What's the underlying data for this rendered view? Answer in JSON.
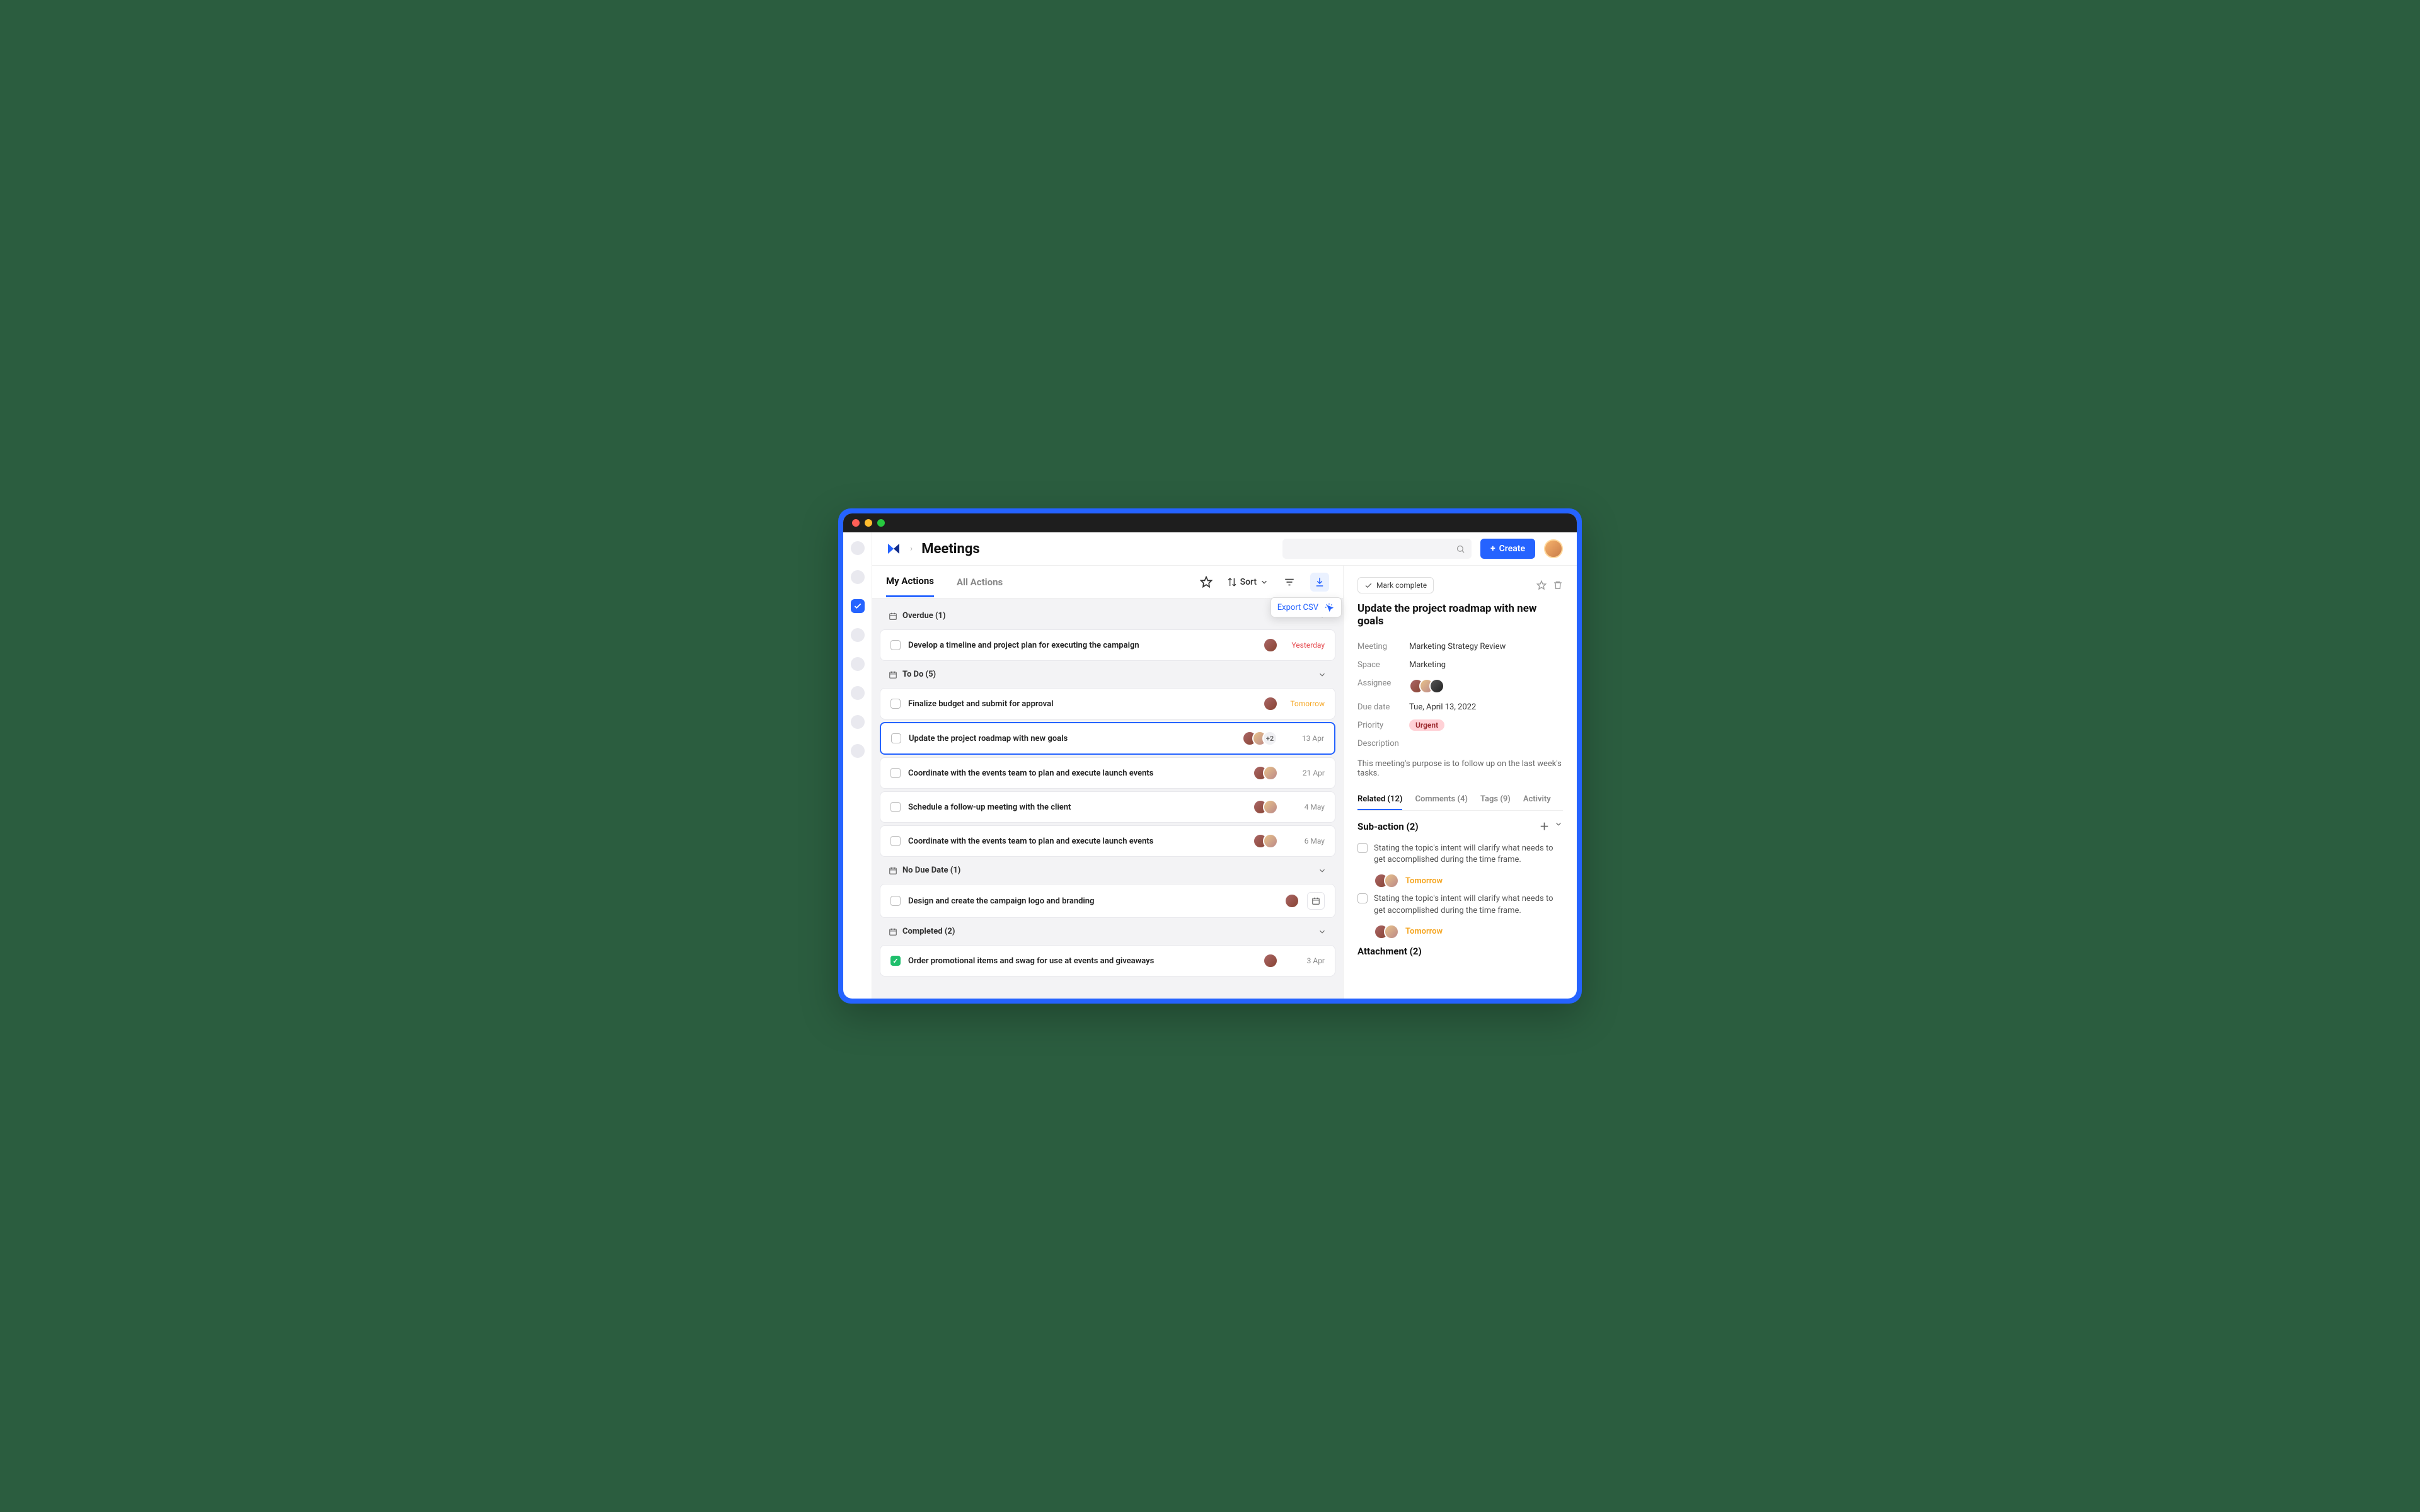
{
  "header": {
    "page_title": "Meetings",
    "create_label": "Create",
    "search_placeholder": ""
  },
  "tabs": {
    "my_actions": "My Actions",
    "all_actions": "All Actions",
    "sort_label": "Sort",
    "export_tooltip": "Export CSV"
  },
  "groups": {
    "overdue": {
      "label": "Overdue (1)",
      "items": [
        {
          "title": "Develop a timeline and project plan for executing the campaign",
          "due": "Yesterday",
          "due_class": "red",
          "avatars": 1
        }
      ]
    },
    "todo": {
      "label": "To Do (5)",
      "items": [
        {
          "title": "Finalize budget and submit for approval",
          "due": "Tomorrow",
          "due_class": "orange",
          "avatars": 1
        },
        {
          "title": "Update the project roadmap with new goals",
          "due": "13 Apr",
          "due_class": "",
          "avatars": 2,
          "extra": "+2",
          "selected": true
        },
        {
          "title": "Coordinate with the events team to plan and execute launch events",
          "due": "21 Apr",
          "due_class": "",
          "avatars": 2
        },
        {
          "title": "Schedule a follow-up meeting with the client",
          "due": "4 May",
          "due_class": "",
          "avatars": 2
        },
        {
          "title": "Coordinate with the events team to plan and execute launch events",
          "due": "6 May",
          "due_class": "",
          "avatars": 2
        }
      ]
    },
    "nodue": {
      "label": "No Due Date (1)",
      "items": [
        {
          "title": "Design and create the campaign logo and branding",
          "due": "",
          "due_class": "",
          "avatars": 1,
          "calendar_slot": true
        }
      ]
    },
    "completed": {
      "label": "Completed (2)",
      "items": [
        {
          "title": "Order promotional items and swag for use at events and giveaways",
          "due": "3 Apr",
          "due_class": "",
          "avatars": 1,
          "done": true
        }
      ]
    }
  },
  "detail": {
    "mark_complete": "Mark complete",
    "title": "Update the project roadmap with new goals",
    "meta": {
      "meeting_label": "Meeting",
      "meeting_val": "Marketing Strategy Review",
      "space_label": "Space",
      "space_val": "Marketing",
      "assignee_label": "Assignee",
      "due_label": "Due date",
      "due_val": "Tue, April 13, 2022",
      "priority_label": "Priority",
      "priority_val": "Urgent",
      "description_label": "Description"
    },
    "description": "This meeting's purpose is to follow up on the last week's tasks.",
    "dtabs": {
      "related": "Related (12)",
      "comments": "Comments (4)",
      "tags": "Tags (9)",
      "activity": "Activity"
    },
    "subactions": {
      "head": "Sub-action (2)",
      "items": [
        {
          "text": "Stating the topic's intent will clarify what needs to get accomplished during the time frame.",
          "due": "Tomorrow"
        },
        {
          "text": "Stating the topic's intent will clarify what needs to get accomplished during the time frame.",
          "due": "Tomorrow"
        }
      ]
    },
    "attachment_head": "Attachment (2)"
  }
}
